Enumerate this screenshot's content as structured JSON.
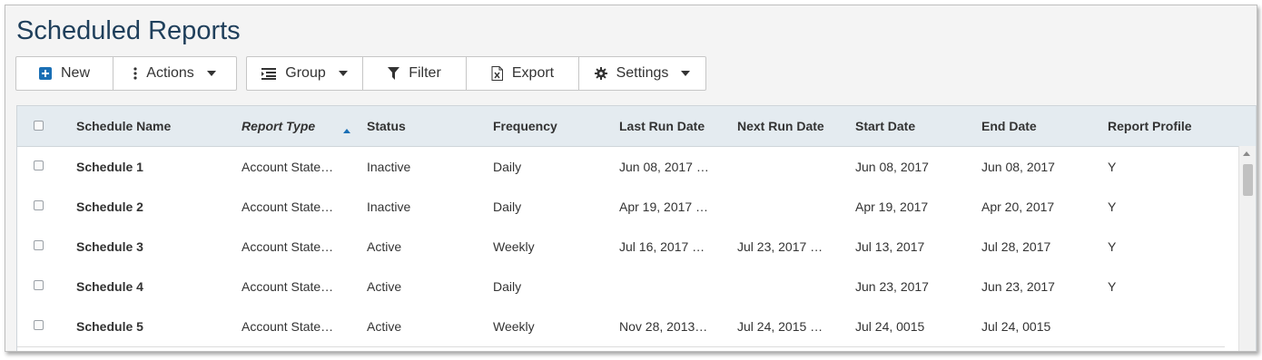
{
  "page": {
    "title": "Scheduled Reports"
  },
  "toolbar": {
    "new_label": "New",
    "actions_label": "Actions",
    "group_label": "Group",
    "filter_label": "Filter",
    "export_label": "Export",
    "settings_label": "Settings",
    "accent_color": "#1a6fb5"
  },
  "table": {
    "columns": [
      "Schedule Name",
      "Report Type",
      "Status",
      "Frequency",
      "Last Run Date",
      "Next Run Date",
      "Start Date",
      "End Date",
      "Report Profile"
    ],
    "sorted_column": "Report Type",
    "sort_direction": "ascending",
    "rows": [
      {
        "name": "Schedule 1",
        "type": "Account State…",
        "status": "Inactive",
        "frequency": "Daily",
        "last_run": "Jun 08, 2017 …",
        "next_run": "",
        "start": "Jun 08, 2017",
        "end": "Jun 08, 2017",
        "profile": "Y"
      },
      {
        "name": "Schedule 2",
        "type": "Account State…",
        "status": "Inactive",
        "frequency": "Daily",
        "last_run": "Apr 19, 2017 …",
        "next_run": "",
        "start": "Apr 19, 2017",
        "end": "Apr 20, 2017",
        "profile": "Y"
      },
      {
        "name": "Schedule 3",
        "type": "Account State…",
        "status": "Active",
        "frequency": "Weekly",
        "last_run": "Jul 16, 2017 …",
        "next_run": "Jul 23, 2017 …",
        "start": "Jul 13, 2017",
        "end": "Jul 28, 2017",
        "profile": "Y"
      },
      {
        "name": "Schedule 4",
        "type": "Account State…",
        "status": "Active",
        "frequency": "Daily",
        "last_run": "",
        "next_run": "",
        "start": "Jun 23, 2017",
        "end": "Jun 23, 2017",
        "profile": "Y"
      },
      {
        "name": "Schedule 5",
        "type": "Account State…",
        "status": "Active",
        "frequency": "Weekly",
        "last_run": "Nov 28, 2013…",
        "next_run": "Jul 24, 2015 …",
        "start": "Jul 24, 0015",
        "end": "Jul 24, 0015",
        "profile": ""
      }
    ]
  }
}
